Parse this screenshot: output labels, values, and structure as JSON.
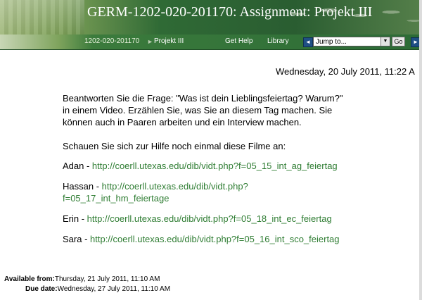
{
  "header": {
    "title": "GERM-1202-020-201170: Assignment: Projekt III"
  },
  "navbar": {
    "breadcrumb_course": "1202-020-201170",
    "breadcrumb_separator": "►",
    "breadcrumb_current": "Projekt III",
    "get_help": "Get Help",
    "library": "Library",
    "jump_placeholder": "Jump to...",
    "go": "Go",
    "arrow_left": "◄",
    "arrow_right": "►",
    "dropdown_arrow": "▼"
  },
  "date_line": "Wednesday, 20 July 2011, 11:22 A",
  "assignment": {
    "intro_line1": "Beantworten Sie die Frage: \"Was ist dein Lieblingsfeiertag? Warum?\"",
    "intro_line2": "in einem Video. Erzählen Sie, was Sie an diesem Tag machen. Sie",
    "intro_line3": "können auch in Paaren arbeiten und ein Interview machen.",
    "films_intro": "Schauen Sie sich zur Hilfe noch einmal diese Filme an:",
    "films": [
      {
        "name": "Adan - ",
        "url": "http://coerll.utexas.edu/dib/vidt.php?f=05_15_int_ag_feiertag"
      },
      {
        "name": "Hassan - ",
        "url_line1": "http://coerll.utexas.edu/dib/vidt.php?",
        "url_line2": "f=05_17_int_hm_feiertage"
      },
      {
        "name": "Erin - ",
        "url": "http://coerll.utexas.edu/dib/vidt.php?f=05_18_int_ec_feiertag"
      },
      {
        "name": "Sara - ",
        "url": "http://coerll.utexas.edu/dib/vidt.php?f=05_16_int_sco_feiertag"
      }
    ]
  },
  "dates": {
    "available_label": "Available from:",
    "available_value": "Thursday, 21 July 2011, 11:10 AM",
    "due_label": "Due date:",
    "due_value": "Wednesday, 27 July 2011, 11:10 AM"
  },
  "colors": {
    "banner_green": "#2f6a35",
    "link_green": "#2f7d33",
    "nav_arrow_blue": "#1f4f84"
  }
}
